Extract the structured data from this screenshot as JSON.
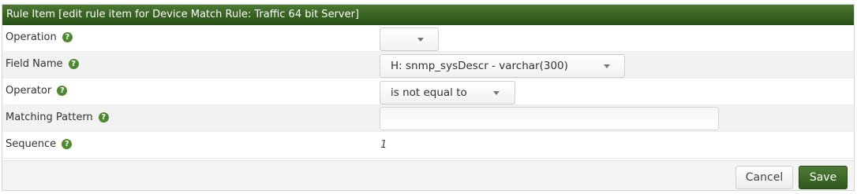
{
  "header": {
    "title": "Rule Item [edit rule item for Device Match Rule: Traffic 64 bit Server]"
  },
  "fields": {
    "operation": {
      "label": "Operation",
      "value": ""
    },
    "field_name": {
      "label": "Field Name",
      "value": "H: snmp_sysDescr - varchar(300)"
    },
    "operator": {
      "label": "Operator",
      "value": "is not equal to"
    },
    "matching_pattern": {
      "label": "Matching Pattern",
      "value": ""
    },
    "sequence": {
      "label": "Sequence",
      "value": "1"
    }
  },
  "help_glyph": "?",
  "buttons": {
    "cancel": "Cancel",
    "save": "Save"
  },
  "colors": {
    "header_bg": "#3a6424",
    "save_bg": "#2f5a1c",
    "help_icon": "#4f8a33",
    "alt_row": "#f2f2f2"
  }
}
